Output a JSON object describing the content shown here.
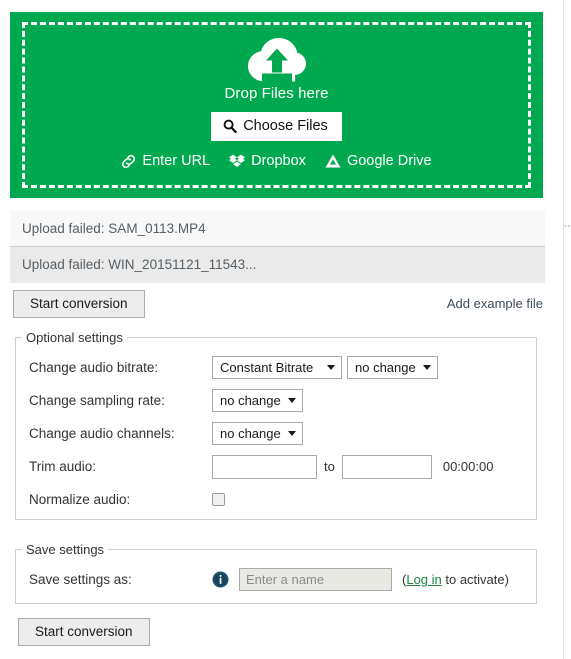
{
  "dropzone": {
    "icon": "cloud-upload-icon",
    "drop_label": "Drop Files here",
    "choose_files_label": "Choose Files",
    "choose_files_icon": "magnifier-icon",
    "services": [
      {
        "label": "Enter URL",
        "icon": "link-icon"
      },
      {
        "label": "Dropbox",
        "icon": "dropbox-icon"
      },
      {
        "label": "Google Drive",
        "icon": "google-drive-icon"
      }
    ],
    "background_color": "#00a94f"
  },
  "status_rows": [
    {
      "text": "Upload failed: SAM_0113.MP4"
    },
    {
      "text": "Upload failed: WIN_20151121_11543..."
    }
  ],
  "actions": {
    "start_conversion_top": "Start conversion",
    "add_example_file": "Add example file",
    "start_conversion_bottom": "Start conversion"
  },
  "optional_settings": {
    "legend": "Optional settings",
    "bitrate": {
      "label": "Change audio bitrate:",
      "mode_value": "Constant Bitrate",
      "quality_value": "no change"
    },
    "sampling": {
      "label": "Change sampling rate:",
      "value": "no change"
    },
    "channels": {
      "label": "Change audio channels:",
      "value": "no change"
    },
    "trim": {
      "label": "Trim audio:",
      "from_value": "",
      "from_placeholder": "",
      "to_word": "to",
      "to_value": "",
      "to_placeholder": "",
      "duration": "00:00:00"
    },
    "normalize": {
      "label": "Normalize audio:",
      "checked": false
    }
  },
  "save_settings": {
    "legend": "Save settings",
    "label": "Save settings as:",
    "info_icon": "info-icon",
    "name_placeholder": "Enter a name",
    "name_value": "",
    "note_open": "(",
    "login_link": "Log in",
    "note_rest": " to activate)"
  }
}
